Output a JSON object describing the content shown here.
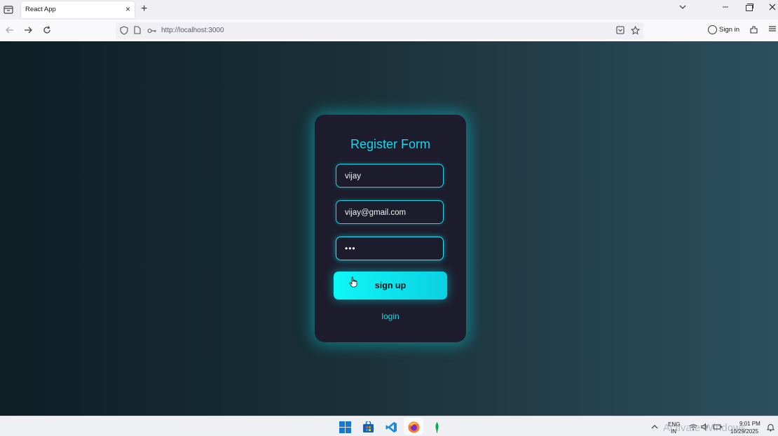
{
  "browser": {
    "tab_title": "React App",
    "tab_close": "×",
    "new_tab": "+",
    "url": "http://localhost:3000",
    "signin_label": "Sign in"
  },
  "form": {
    "title": "Register Form",
    "name_value": "vijay",
    "email_value": "vijay@gmail.com",
    "password_mask": "•••",
    "submit_label": "sign up",
    "login_link": "login"
  },
  "taskbar": {
    "lang_line1": "ENG",
    "lang_line2": "IN",
    "time": "9:01 PM",
    "date": "10/29/2025",
    "watermark": "Activate Windows"
  },
  "colors": {
    "accent": "#14d7ea",
    "card_bg": "#1d1c2c",
    "button_start": "#0ff7f7",
    "button_end": "#0bd0e2"
  }
}
